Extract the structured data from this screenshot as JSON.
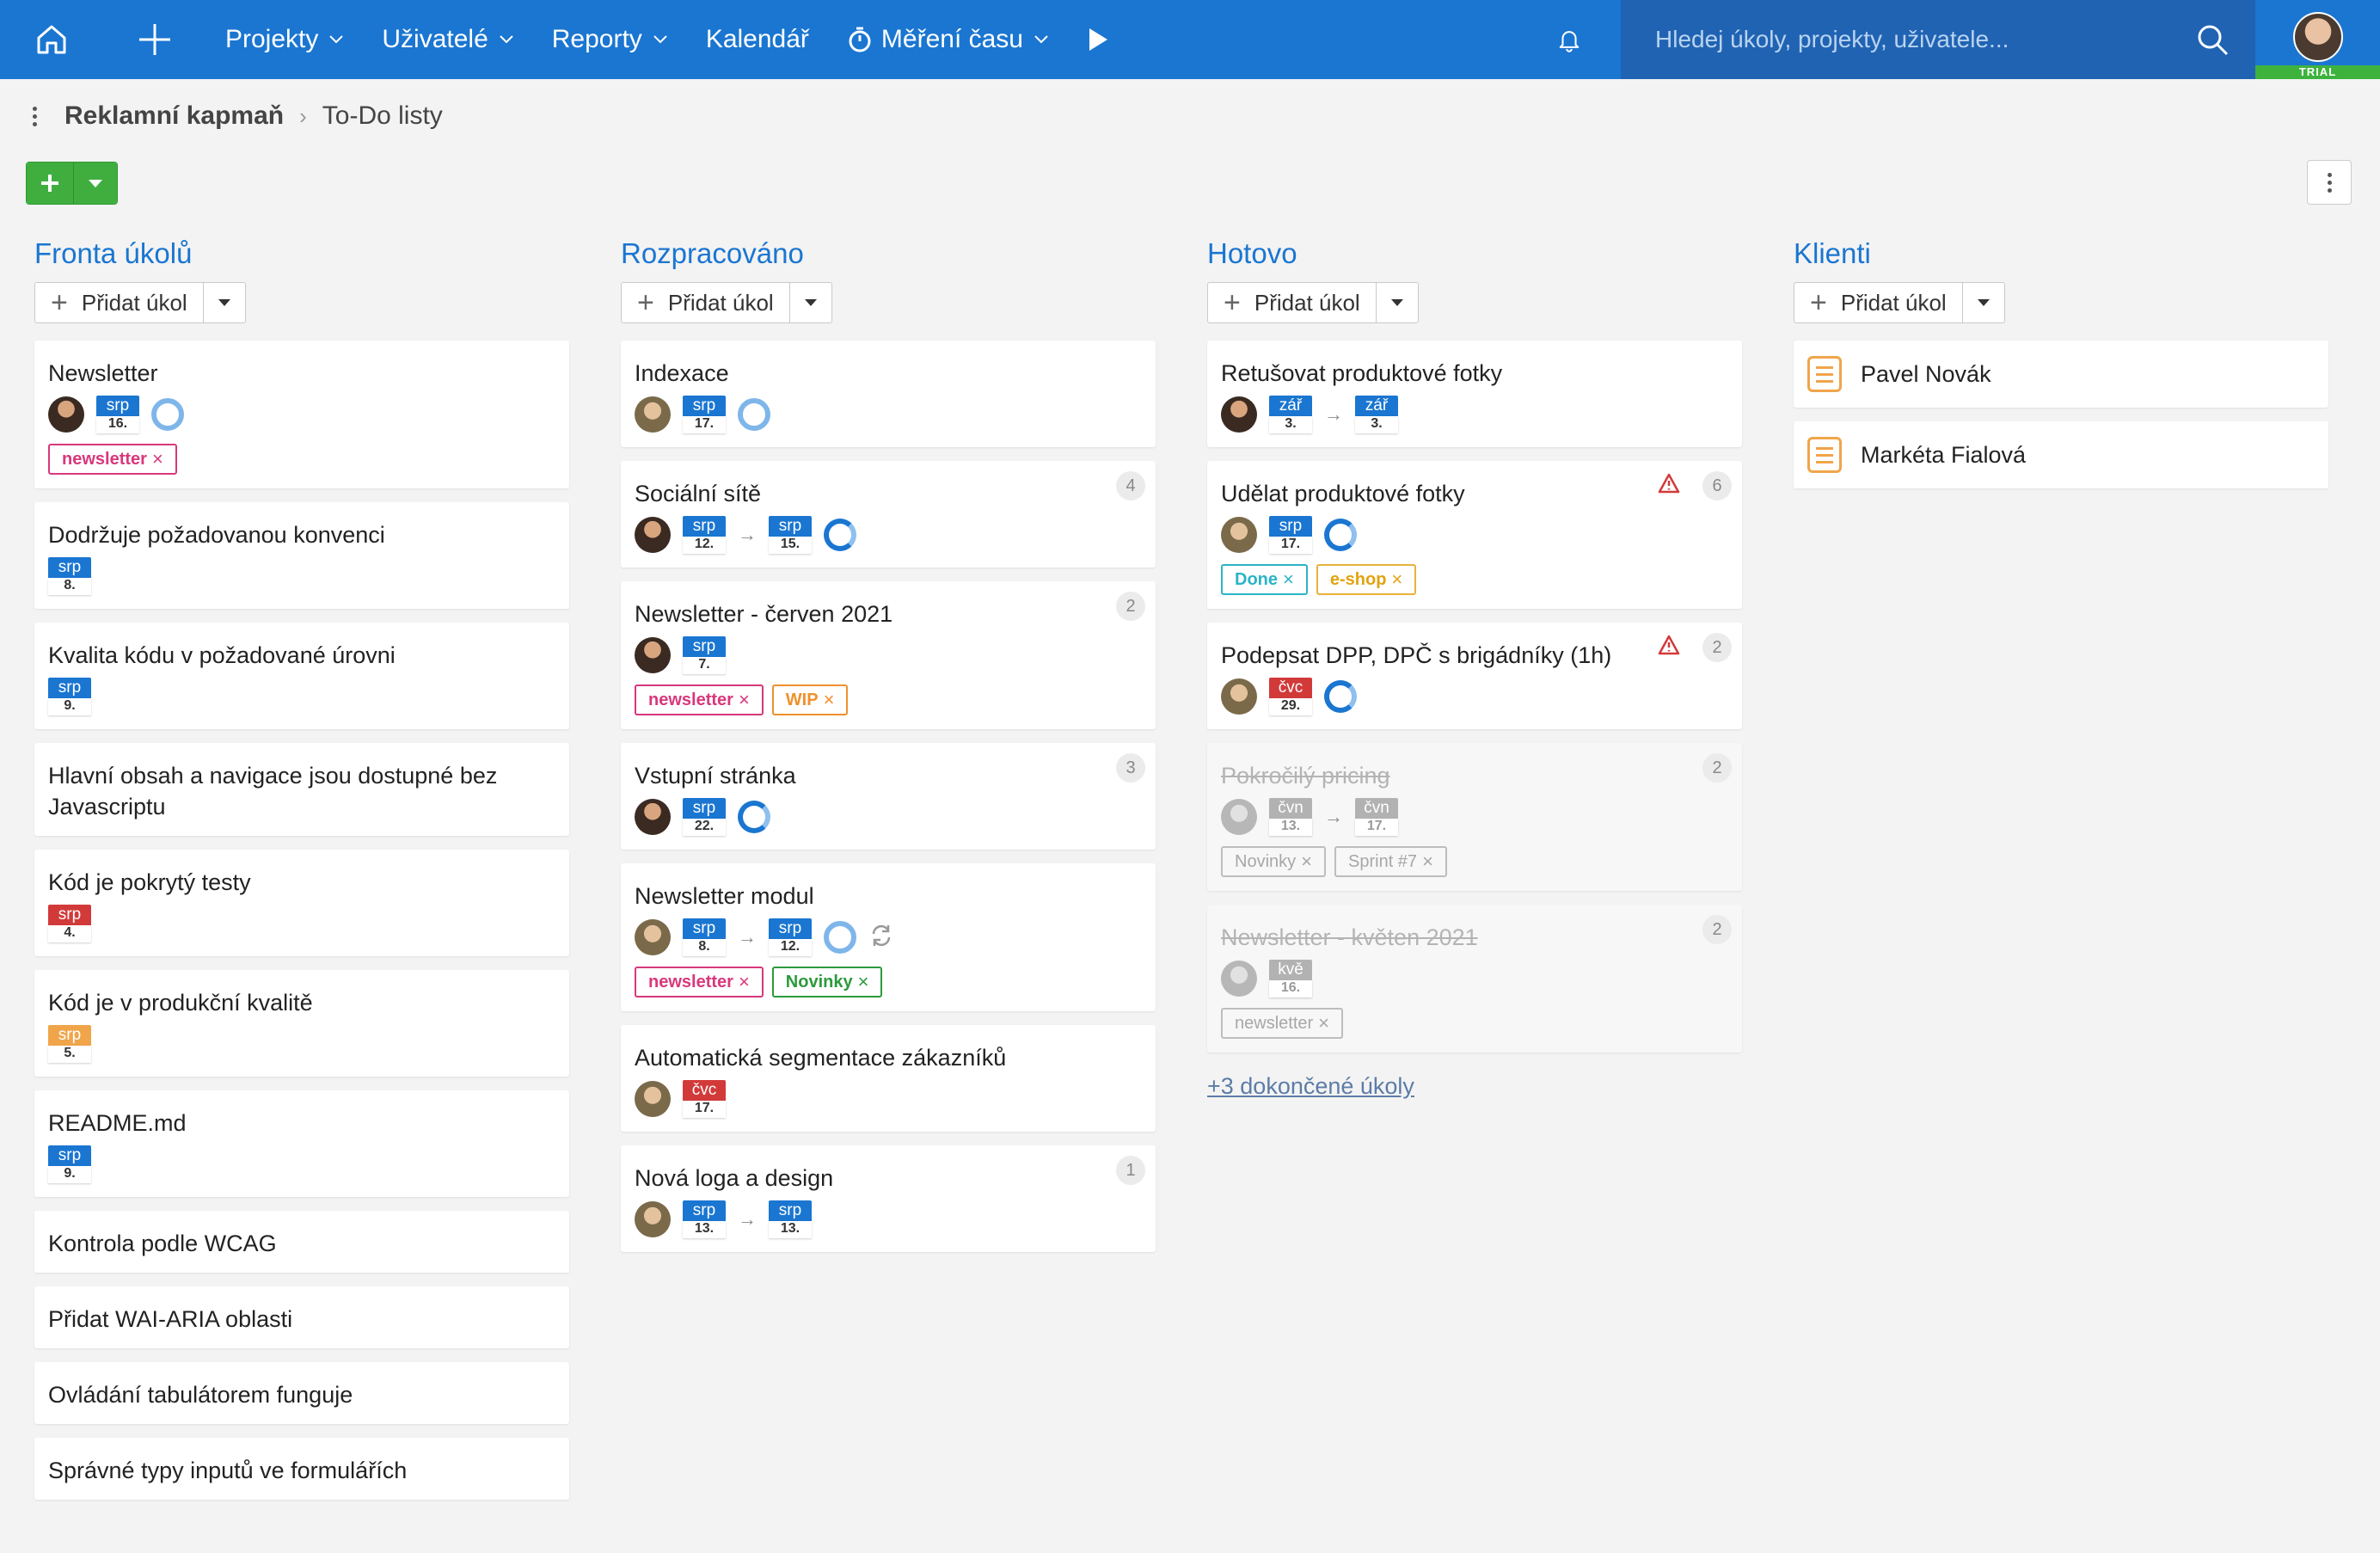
{
  "nav": {
    "projects": "Projekty",
    "users": "Uživatelé",
    "reports": "Reporty",
    "calendar": "Kalendář",
    "time_tracking": "Měření času",
    "search_placeholder": "Hledej úkoly, projekty, uživatele...",
    "trial_label": "TRIAL"
  },
  "breadcrumb": {
    "project": "Reklamní kapmaň",
    "current": "To-Do listy"
  },
  "add_task_label": "Přidat úkol",
  "columns": [
    {
      "title": "Fronta úkolů",
      "cards": [
        {
          "title": "Newsletter",
          "dates": [
            {
              "m": "srp",
              "d": "16."
            }
          ],
          "tags": [
            "newsletter"
          ]
        },
        {
          "title": "Dodržuje požadovanou konvenci",
          "dates": [
            {
              "m": "srp",
              "d": "8."
            }
          ]
        },
        {
          "title": "Kvalita kódu v požadované úrovni",
          "dates": [
            {
              "m": "srp",
              "d": "9."
            }
          ]
        },
        {
          "title": "Hlavní obsah a navigace jsou dostupné bez Javascriptu"
        },
        {
          "title": "Kód je pokrytý testy",
          "dates": [
            {
              "m": "srp",
              "d": "4."
            }
          ]
        },
        {
          "title": "Kód je v produkční kvalitě",
          "dates": [
            {
              "m": "srp",
              "d": "5."
            }
          ]
        },
        {
          "title": "README.md",
          "dates": [
            {
              "m": "srp",
              "d": "9."
            }
          ]
        },
        {
          "title": "Kontrola podle WCAG"
        },
        {
          "title": "Přidat WAI-ARIA oblasti"
        },
        {
          "title": "Ovládání tabulátorem funguje"
        },
        {
          "title": "Správné typy inputů ve formulářích"
        }
      ]
    },
    {
      "title": "Rozpracováno",
      "cards": [
        {
          "title": "Indexace",
          "dates": [
            {
              "m": "srp",
              "d": "17."
            }
          ]
        },
        {
          "title": "Sociální sítě",
          "count": "4",
          "dates": [
            {
              "m": "srp",
              "d": "12."
            },
            {
              "m": "srp",
              "d": "15."
            }
          ]
        },
        {
          "title": "Newsletter - červen 2021",
          "count": "2",
          "dates": [
            {
              "m": "srp",
              "d": "7."
            }
          ],
          "tags": [
            "newsletter",
            "WIP"
          ]
        },
        {
          "title": "Vstupní stránka",
          "count": "3",
          "dates": [
            {
              "m": "srp",
              "d": "22."
            }
          ]
        },
        {
          "title": "Newsletter modul",
          "dates": [
            {
              "m": "srp",
              "d": "8."
            },
            {
              "m": "srp",
              "d": "12."
            }
          ],
          "tags": [
            "newsletter",
            "Novinky"
          ]
        },
        {
          "title": "Automatická segmentace zákazníků",
          "dates": [
            {
              "m": "čvc",
              "d": "17."
            }
          ]
        },
        {
          "title": "Nová loga a design",
          "count": "1",
          "dates": [
            {
              "m": "srp",
              "d": "13."
            },
            {
              "m": "srp",
              "d": "13."
            }
          ]
        }
      ]
    },
    {
      "title": "Hotovo",
      "cards": [
        {
          "title": "Retušovat produktové fotky",
          "dates": [
            {
              "m": "zář",
              "d": "3."
            },
            {
              "m": "zář",
              "d": "3."
            }
          ]
        },
        {
          "title": "Udělat produktové fotky",
          "count": "6",
          "dates": [
            {
              "m": "srp",
              "d": "17."
            }
          ],
          "tags": [
            "Done",
            "e-shop"
          ]
        },
        {
          "title": "Podepsat DPP, DPČ s brigádníky (1h)",
          "count": "2",
          "dates": [
            {
              "m": "čvc",
              "d": "29."
            }
          ]
        },
        {
          "title": "Pokročilý pricing",
          "count": "2",
          "dates": [
            {
              "m": "čvn",
              "d": "13."
            },
            {
              "m": "čvn",
              "d": "17."
            }
          ],
          "tags": [
            "Novinky",
            "Sprint #7"
          ]
        },
        {
          "title": "Newsletter - květen 2021",
          "count": "2",
          "dates": [
            {
              "m": "kvě",
              "d": "16."
            }
          ],
          "tags": [
            "newsletter"
          ]
        }
      ],
      "completed_link": "+3 dokončené úkoly"
    },
    {
      "title": "Klienti",
      "cards": [
        {
          "title": "Pavel Novák"
        },
        {
          "title": "Markéta Fialová"
        }
      ]
    }
  ],
  "colors": {
    "header": "#1a76d1",
    "search_bg": "#2063b3",
    "accent": "#1a76d1",
    "green": "#3fae3f",
    "date_red": "#d23a3a",
    "date_orange": "#f0a54a",
    "tag_newsletter": "#d8387c",
    "tag_wip": "#f0902c",
    "tag_novinky": "#2c9a3c",
    "tag_done": "#2bb4c6",
    "tag_eshop": "#e2a310",
    "warning": "#d23a3a"
  },
  "icons": [
    "home-icon",
    "plus-icon",
    "chevron-down-icon",
    "stopwatch-icon",
    "play-icon",
    "bell-icon",
    "search-icon",
    "kebab-icon",
    "warning-icon",
    "sync-icon",
    "progress-ring-icon",
    "client-note-icon"
  ]
}
